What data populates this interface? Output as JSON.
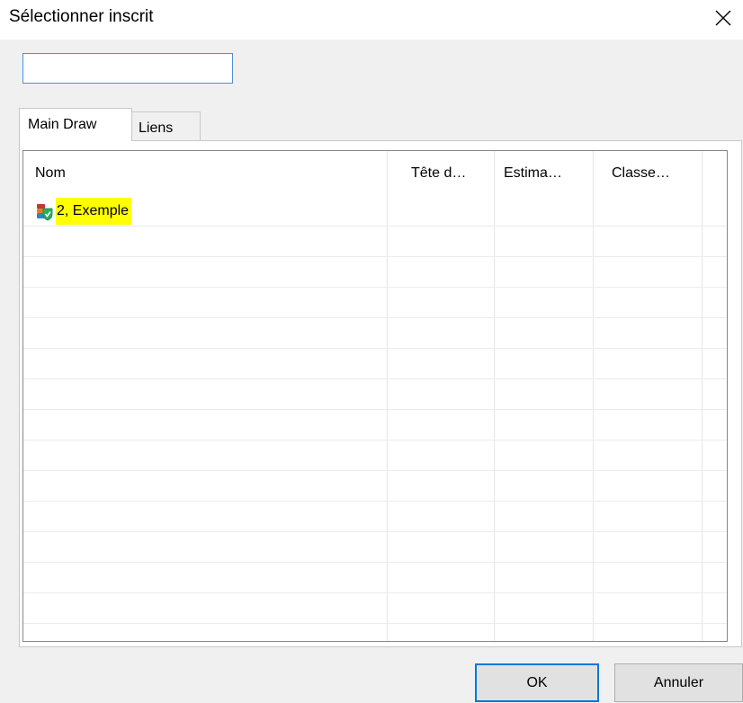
{
  "dialog": {
    "title": "Sélectionner inscrit",
    "close_icon": "close-icon"
  },
  "search": {
    "value": "",
    "placeholder": ""
  },
  "tabs": [
    {
      "label": "Main Draw",
      "active": true
    },
    {
      "label": "Liens",
      "active": false
    }
  ],
  "table": {
    "columns": [
      "Nom",
      "Tête d…",
      "Estima…",
      "Classe…"
    ],
    "rows": [
      {
        "icon": "player-entry-icon",
        "nom": "2, Exemple",
        "highlight_color": "#ffff00"
      }
    ]
  },
  "buttons": {
    "ok_label": "OK",
    "cancel_label": "Annuler"
  },
  "colors": {
    "accent": "#0078d7",
    "highlight": "#ffff00"
  }
}
